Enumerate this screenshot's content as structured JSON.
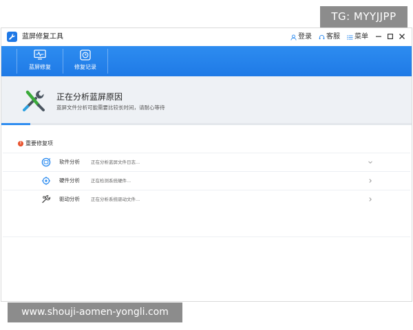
{
  "watermarks": {
    "top": "TG: MYYJJPP",
    "bottom": "www.shouji-aomen-yongli.com"
  },
  "window": {
    "title": "蓝屏修复工具",
    "actions": {
      "login": "登录",
      "service": "客服",
      "menu": "菜单"
    }
  },
  "toolbar": {
    "repair_label": "蓝屏修复",
    "history_label": "修复记录"
  },
  "banner": {
    "title": "正在分析蓝屏原因",
    "subtitle": "蓝屏文件分析可能需要比较长时间，请耐心等待",
    "progress": 0.07
  },
  "section": {
    "label": "重要修复项"
  },
  "rows": [
    {
      "name": "软件分析",
      "status": "正在分析蓝屏文件日志...",
      "chevron": "down"
    },
    {
      "name": "硬件分析",
      "status": "正在检测系统硬件...",
      "chevron": "right"
    },
    {
      "name": "驱动分析",
      "status": "正在分析系统驱动文件...",
      "chevron": "right"
    }
  ],
  "colors": {
    "accent": "#2d8cf0",
    "banner_bg": "#eef1f5",
    "warning": "#e8502b"
  },
  "icons": {
    "app": "wrench-icon",
    "login": "user-icon",
    "service": "headset-icon",
    "menu": "list-icon",
    "repair": "monitor-icon",
    "history": "history-icon",
    "banner": "tools-icon",
    "software": "software-icon",
    "hardware": "hardware-icon",
    "driver": "driver-icon"
  }
}
